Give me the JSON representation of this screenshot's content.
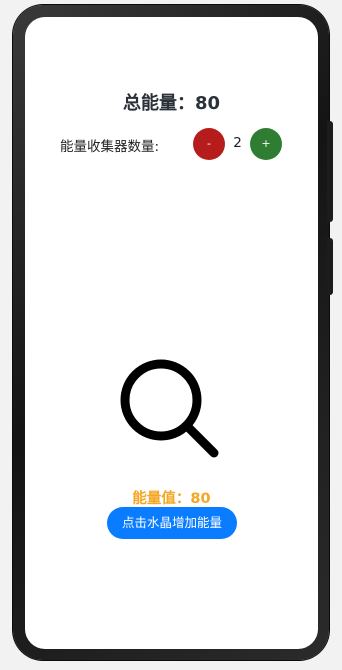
{
  "header": {
    "total_label": "总能量：",
    "total_value": "80"
  },
  "collector": {
    "label": "能量收集器数量:",
    "minus_label": "-",
    "count": "2",
    "plus_label": "+"
  },
  "crystal": {
    "icon": "search-icon"
  },
  "energy": {
    "label": "能量值：",
    "value": "80"
  },
  "action": {
    "button_label": "点击水晶增加能量"
  },
  "colors": {
    "minus_button": "#b71c1c",
    "plus_button": "#2e7d32",
    "energy_text": "#f5a623",
    "action_button": "#0a7cff"
  }
}
